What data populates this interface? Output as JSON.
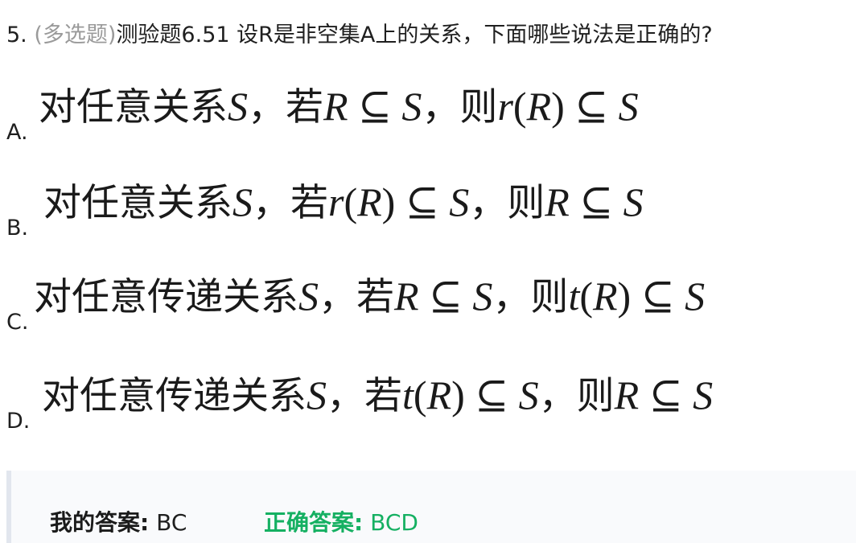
{
  "question": {
    "number": "5.",
    "type": "(多选题)",
    "text": "测验题6.51 设R是非空集A上的关系，下面哪些说法是正确的?"
  },
  "options": [
    {
      "letter": "A.",
      "t1": "对任意关系",
      "s1": "S",
      "t2": "，若",
      "m2": "R ⊆ S",
      "t3": "，则",
      "m3a": "r",
      "u3": "(",
      "m3b": "R",
      "u4": ")",
      "m3c": " ⊆ S"
    },
    {
      "letter": "B.",
      "t1": "对任意关系",
      "s1": "S",
      "t2": "，若",
      "m2a": "r",
      "u2": "(",
      "m2b": "R",
      "u3": ")",
      "m2c": " ⊆ S",
      "t3": "，则",
      "m3": "R ⊆ S"
    },
    {
      "letter": "C.",
      "t1": "对任意传递关系",
      "s1": "S",
      "t2": "，若",
      "m2": "R ⊆ S",
      "t3": "，则",
      "m3a": "t",
      "u3": "(",
      "m3b": "R",
      "u4": ")",
      "m3c": " ⊆ S"
    },
    {
      "letter": "D.",
      "t1": "对任意传递关系",
      "s1": "S",
      "t2": "，若",
      "m2a": "t",
      "u2": "(",
      "m2b": "R",
      "u3": ")",
      "m2c": " ⊆ S",
      "t3": "，则",
      "m3": "R ⊆ S"
    }
  ],
  "answer": {
    "my_label": "我的答案:",
    "my_value": "BC",
    "correct_label": "正确答案:",
    "correct_value": "BCD"
  },
  "colors": {
    "question_type": "#9a9a9a",
    "correct_answer": "#15b062",
    "answer_bar": "#e2e6ee"
  }
}
